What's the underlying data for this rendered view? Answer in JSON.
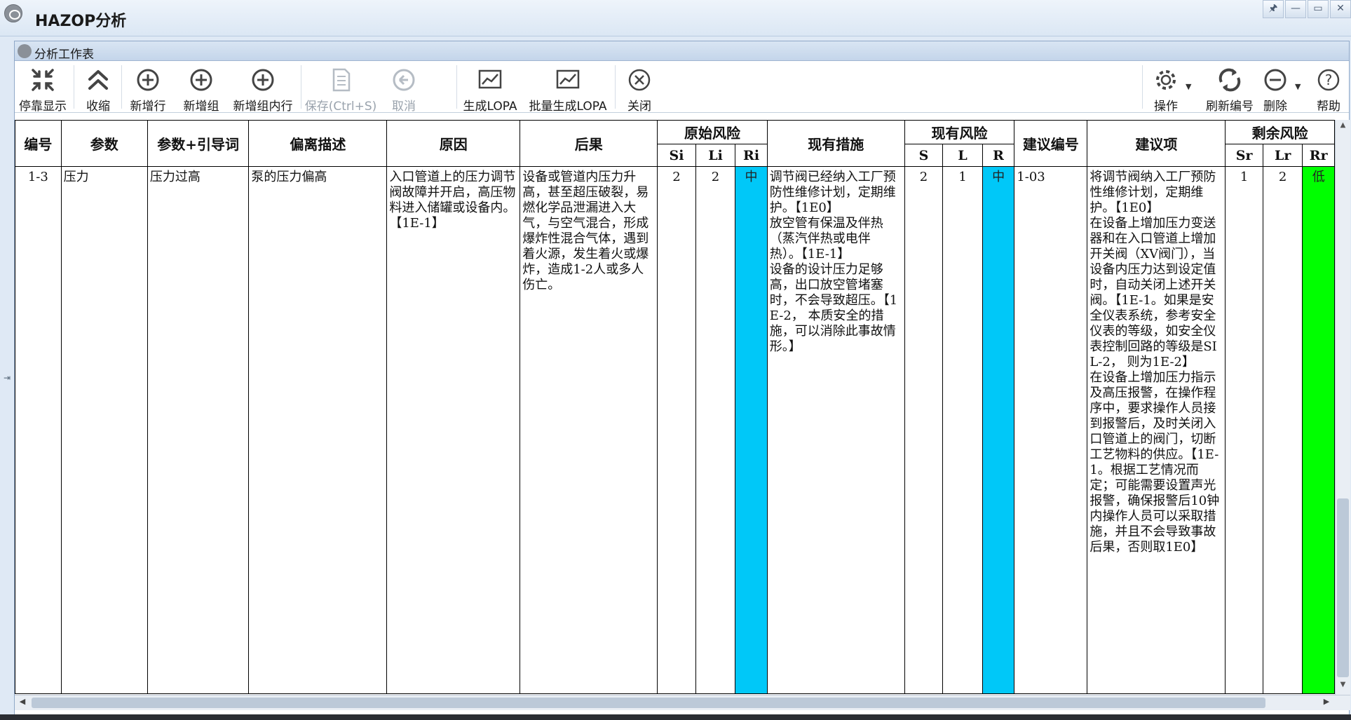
{
  "app": {
    "title": "HAZOP分析"
  },
  "window_controls": {
    "pin": "🖈",
    "minimize": "—",
    "restore": "▭",
    "close": "✕"
  },
  "panel": {
    "title": "分析工作表"
  },
  "toolbar": {
    "undock": "停靠显示",
    "collapse": "收缩",
    "add_row": "新增行",
    "add_group": "新增组",
    "add_group_row": "新增组内行",
    "save": "保存(Ctrl+S)",
    "cancel": "取消",
    "gen_lopa": "生成LOPA",
    "batch_lopa": "批量生成LOPA",
    "close": "关闭",
    "operate": "操作",
    "refresh_number": "刷新编号",
    "delete": "删除",
    "help": "帮助"
  },
  "headers": {
    "number": "编号",
    "param": "参数",
    "param_guide": "参数+引导词",
    "deviation": "偏离描述",
    "cause": "原因",
    "consequence": "后果",
    "orig_risk": "原始风险",
    "si": "Si",
    "li": "Li",
    "ri": "Ri",
    "measures": "现有措施",
    "curr_risk": "现有风险",
    "s": "S",
    "l": "L",
    "r": "R",
    "sugg_no": "建议编号",
    "suggestion": "建议项",
    "resid_risk": "剩余风险",
    "sr": "Sr",
    "lr": "Lr",
    "rr": "Rr"
  },
  "rows": [
    {
      "number": "1-3",
      "param": "压力",
      "param_guide": "压力过高",
      "deviation": "泵的压力偏高",
      "cause": "入口管道上的压力调节阀故障并开启，高压物料进入储罐或设备内。【1E-1】",
      "consequence": "设备或管道内压力升高，甚至超压破裂，易燃化学品泄漏进入大气，与空气混合，形成爆炸性混合气体，遇到着火源，发生着火或爆炸，造成1-2人或多人伤亡。",
      "si": "2",
      "li": "2",
      "ri": "中",
      "measures": "调节阀已经纳入工厂预防性维修计划，定期维护。【1E0】\n放空管有保温及伴热（蒸汽伴热或电伴热）。【1E-1】\n设备的设计压力足够高，出口放空管堵塞时，不会导致超压。【1E-2， 本质安全的措施，可以消除此事故情形。】",
      "s": "2",
      "l": "1",
      "r": "中",
      "sugg_no": "1-03",
      "suggestion": "将调节阀纳入工厂预防性维修计划，定期维护。【1E0】\n在设备上增加压力变送器和在入口管道上增加开关阀（XV阀门），当设备内压力达到设定值时，自动关闭上述开关阀。【1E-1。如果是安全仪表系统，参考安全仪表的等级，如安全仪表控制回路的等级是SIL-2， 则为1E-2】\n在设备上增加压力指示及高压报警，在操作程序中，要求操作人员接到报警后，及时关闭入口管道上的阀门，切断工艺物料的供应。【1E-1。根据工艺情况而定；可能需要设置声光报警，确保报警后10钟内操作人员可以采取措施，并且不会导致事故后果，否则取1E0】",
      "sr": "1",
      "lr": "2",
      "rr": "低"
    }
  ],
  "colors": {
    "medium_risk": "#00c8f8",
    "low_risk": "#00ff00",
    "panel_border": "#8fa8c8"
  }
}
